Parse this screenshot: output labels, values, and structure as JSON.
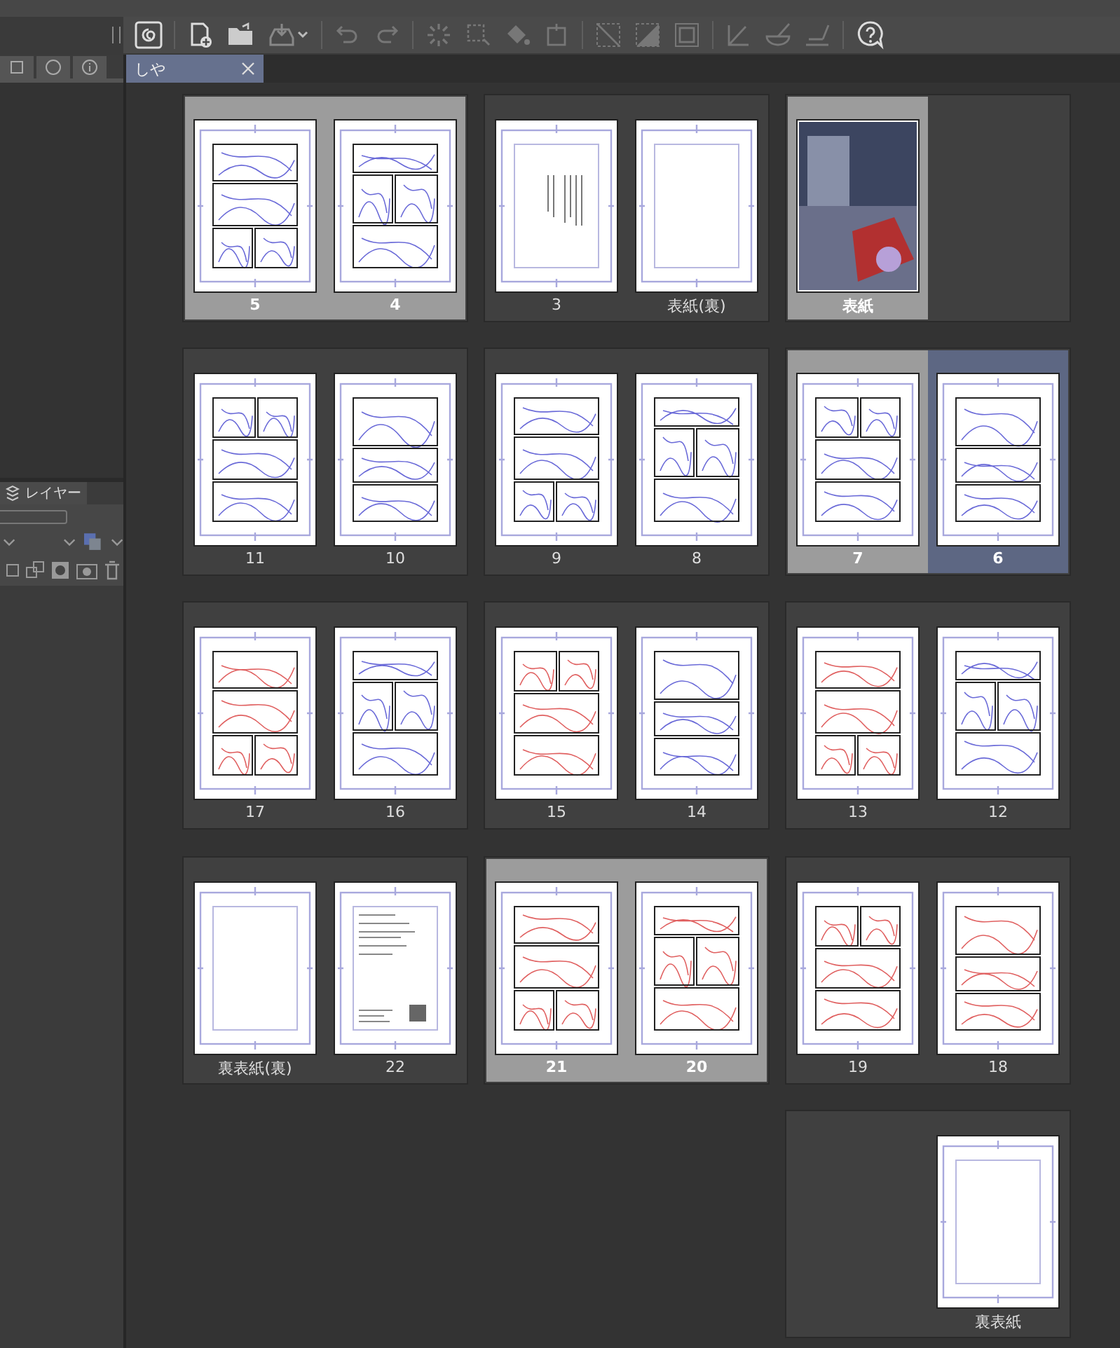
{
  "document_tab": {
    "label": "しや",
    "selected": true
  },
  "layer_panel": {
    "tab": "レイヤー"
  },
  "spreads": [
    {
      "kind": "spread",
      "pages": [
        {
          "kind": "sketch",
          "color": "#6a6ad8",
          "label": "5",
          "selected": true,
          "active": false
        },
        {
          "kind": "sketch",
          "color": "#6a6ad8",
          "label": "4",
          "selected": true,
          "active": false
        }
      ]
    },
    {
      "kind": "spread",
      "pages": [
        {
          "kind": "text",
          "label": "3",
          "selected": false,
          "active": false
        },
        {
          "kind": "blank",
          "label": "表紙(裏)",
          "selected": false,
          "active": false
        }
      ]
    },
    {
      "kind": "spread",
      "pages": [
        {
          "kind": "cover",
          "label": "表紙",
          "selected": true,
          "active": false
        },
        {
          "kind": "empty"
        }
      ]
    },
    {
      "kind": "spread",
      "pages": [
        {
          "kind": "sketch",
          "color": "#6a6ad8",
          "label": "11",
          "selected": false,
          "active": false
        },
        {
          "kind": "sketch",
          "color": "#6a6ad8",
          "label": "10",
          "selected": false,
          "active": false
        }
      ]
    },
    {
      "kind": "spread",
      "pages": [
        {
          "kind": "sketch",
          "color": "#6a6ad8",
          "label": "9",
          "selected": false,
          "active": false
        },
        {
          "kind": "sketch",
          "color": "#6a6ad8",
          "label": "8",
          "selected": false,
          "active": false
        }
      ]
    },
    {
      "kind": "spread",
      "pages": [
        {
          "kind": "sketch",
          "color": "#6a6ad8",
          "label": "7",
          "selected": true,
          "active": false
        },
        {
          "kind": "sketch",
          "color": "#6a6ad8",
          "label": "6",
          "selected": true,
          "active": true
        }
      ]
    },
    {
      "kind": "spread",
      "pages": [
        {
          "kind": "sketch",
          "color": "#e06060",
          "label": "17",
          "selected": false,
          "active": false
        },
        {
          "kind": "sketch",
          "color": "#6a6ad8",
          "label": "16",
          "selected": false,
          "active": false
        }
      ]
    },
    {
      "kind": "spread",
      "pages": [
        {
          "kind": "sketch",
          "color": "#e06060",
          "label": "15",
          "selected": false,
          "active": false
        },
        {
          "kind": "sketch",
          "color": "#6a6ad8",
          "label": "14",
          "selected": false,
          "active": false
        }
      ]
    },
    {
      "kind": "spread",
      "pages": [
        {
          "kind": "sketch",
          "color": "#e06060",
          "label": "13",
          "selected": false,
          "active": false
        },
        {
          "kind": "sketch",
          "color": "#6a6ad8",
          "label": "12",
          "selected": false,
          "active": false
        }
      ]
    },
    {
      "kind": "spread",
      "pages": [
        {
          "kind": "blank",
          "label": "裏表紙(裏)",
          "selected": false,
          "active": false
        },
        {
          "kind": "afterword",
          "label": "22",
          "selected": false,
          "active": false
        }
      ]
    },
    {
      "kind": "spread",
      "pages": [
        {
          "kind": "sketch",
          "color": "#e06060",
          "label": "21",
          "selected": true,
          "active": false
        },
        {
          "kind": "sketch",
          "color": "#e06060",
          "label": "20",
          "selected": true,
          "active": false
        }
      ]
    },
    {
      "kind": "spread",
      "pages": [
        {
          "kind": "sketch",
          "color": "#e06060",
          "label": "19",
          "selected": false,
          "active": false
        },
        {
          "kind": "sketch",
          "color": "#e06060",
          "label": "18",
          "selected": false,
          "active": false
        }
      ]
    },
    {
      "kind": "gap"
    },
    {
      "kind": "gap"
    },
    {
      "kind": "spread",
      "pages": [
        {
          "kind": "empty"
        },
        {
          "kind": "blank",
          "label": "裏表紙",
          "selected": false,
          "active": false
        }
      ]
    }
  ]
}
